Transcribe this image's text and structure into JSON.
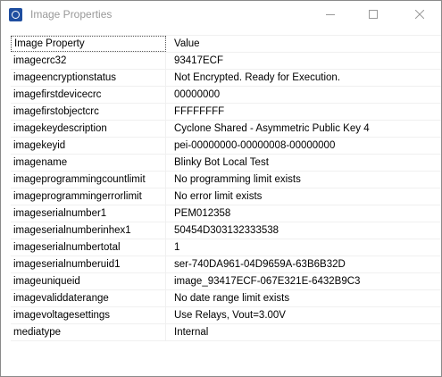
{
  "window": {
    "title": "Image Properties",
    "controls": {
      "minimize": "—",
      "maximize": "☐",
      "close": "✕"
    }
  },
  "table": {
    "headers": {
      "property": "Image Property",
      "value": "Value"
    },
    "rows": [
      {
        "property": "imagecrc32",
        "value": "93417ECF"
      },
      {
        "property": "imageencryptionstatus",
        "value": "Not Encrypted. Ready for Execution."
      },
      {
        "property": "imagefirstdevicecrc",
        "value": "00000000"
      },
      {
        "property": "imagefirstobjectcrc",
        "value": "FFFFFFFF"
      },
      {
        "property": "imagekeydescription",
        "value": "Cyclone Shared - Asymmetric Public Key 4"
      },
      {
        "property": "imagekeyid",
        "value": "pei-00000000-00000008-00000000"
      },
      {
        "property": "imagename",
        "value": "Blinky Bot Local Test"
      },
      {
        "property": "imageprogrammingcountlimit",
        "value": "No programming limit exists"
      },
      {
        "property": "imageprogrammingerrorlimit",
        "value": "No error limit exists"
      },
      {
        "property": "imageserialnumber1",
        "value": "PEM012358"
      },
      {
        "property": "imageserialnumberinhex1",
        "value": "50454D303132333538"
      },
      {
        "property": "imageserialnumbertotal",
        "value": "1"
      },
      {
        "property": "imageserialnumberuid1",
        "value": "ser-740DA961-04D9659A-63B6B32D"
      },
      {
        "property": "imageuniqueid",
        "value": "image_93417ECF-067E321E-6432B9C3"
      },
      {
        "property": "imagevaliddaterange",
        "value": "No date range limit exists"
      },
      {
        "property": "imagevoltagesettings",
        "value": "Use Relays, Vout=3.00V"
      },
      {
        "property": "mediatype",
        "value": "Internal"
      }
    ]
  }
}
